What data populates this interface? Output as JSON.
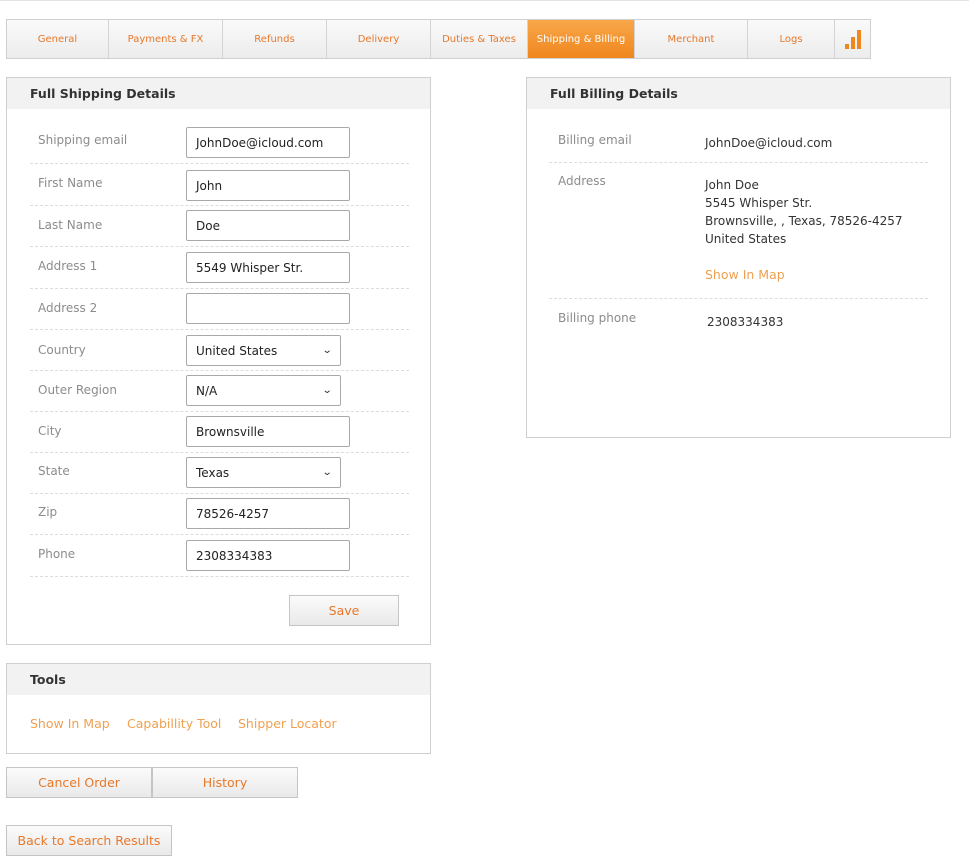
{
  "tabs": [
    {
      "label": "General"
    },
    {
      "label": "Payments & FX"
    },
    {
      "label": "Refunds"
    },
    {
      "label": "Delivery"
    },
    {
      "label": "Duties & Taxes"
    },
    {
      "label": "Shipping & Billing"
    },
    {
      "label": "Merchant"
    },
    {
      "label": "Logs"
    }
  ],
  "active_tab": "Shipping & Billing",
  "shipping": {
    "title": "Full Shipping Details",
    "fields": {
      "email": {
        "label": "Shipping email",
        "value": "JohnDoe@icloud.com"
      },
      "first_name": {
        "label": "First Name",
        "value": "John"
      },
      "last_name": {
        "label": "Last Name",
        "value": "Doe"
      },
      "address1": {
        "label": "Address 1",
        "value": "5549 Whisper Str."
      },
      "address2": {
        "label": "Address 2",
        "value": ""
      },
      "country": {
        "label": "Country",
        "value": "United States"
      },
      "outer_region": {
        "label": "Outer Region",
        "value": "N/A"
      },
      "city": {
        "label": "City",
        "value": "Brownsville"
      },
      "state": {
        "label": "State",
        "value": "Texas"
      },
      "zip": {
        "label": "Zip",
        "value": "78526-4257"
      },
      "phone": {
        "label": "Phone",
        "value": "2308334383"
      }
    },
    "save_label": "Save"
  },
  "billing": {
    "title": "Full Billing Details",
    "email_label": "Billing email",
    "email_value": "JohnDoe@icloud.com",
    "address_label": "Address",
    "address_lines": [
      "John Doe",
      "5545 Whisper Str.",
      "Brownsville, , Texas, 78526-4257",
      "United States"
    ],
    "show_in_map": "Show In Map",
    "phone_label": "Billing phone",
    "phone_value": "2308334383"
  },
  "tools": {
    "title": "Tools",
    "links": [
      "Show In Map",
      "Capabillity Tool",
      "Shipper Locator"
    ]
  },
  "actions": {
    "cancel_order": "Cancel Order",
    "history": "History",
    "back_to_search": "Back to Search Results"
  },
  "colors": {
    "accent": "#f0861e",
    "link": "#f0a050",
    "button_text": "#e8782a"
  }
}
